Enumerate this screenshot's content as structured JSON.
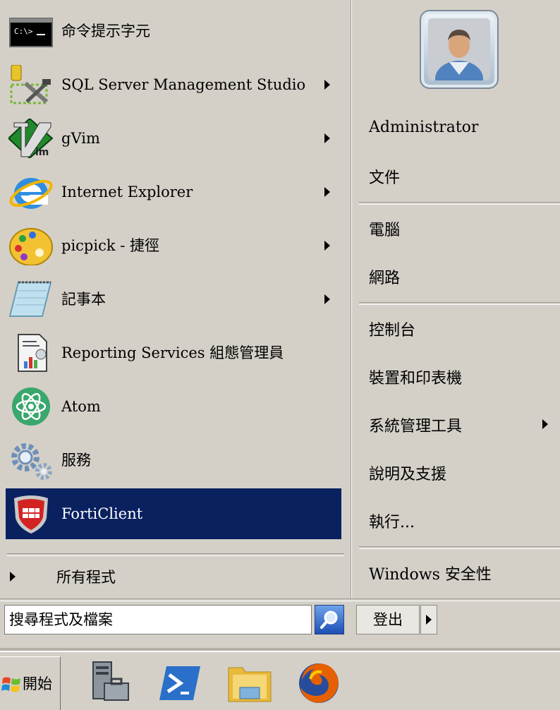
{
  "programs": [
    {
      "label": "命令提示字元",
      "icon": "cmd-icon",
      "submenu": false
    },
    {
      "label": "SQL Server Management Studio",
      "icon": "sql-tools-icon",
      "submenu": true
    },
    {
      "label": "gVim",
      "icon": "gvim-icon",
      "submenu": true
    },
    {
      "label": "Internet Explorer",
      "icon": "internet-explorer-icon",
      "submenu": true
    },
    {
      "label": "picpick - 捷徑",
      "icon": "picpick-palette-icon",
      "submenu": true
    },
    {
      "label": "記事本",
      "icon": "notepad-icon",
      "submenu": true
    },
    {
      "label": "Reporting Services 組態管理員",
      "icon": "reporting-services-icon",
      "submenu": false
    },
    {
      "label": "Atom",
      "icon": "atom-icon",
      "submenu": false
    },
    {
      "label": "服務",
      "icon": "services-gears-icon",
      "submenu": false
    },
    {
      "label": "FortiClient",
      "icon": "forticlient-shield-icon",
      "submenu": false,
      "selected": true
    }
  ],
  "all_programs_label": "所有程式",
  "search": {
    "placeholder": "搜尋程式及檔案"
  },
  "logout_label": "登出",
  "right": {
    "username": "Administrator",
    "documents": "文件",
    "computer": "電腦",
    "network": "網路",
    "control_panel": "控制台",
    "devices_printers": "裝置和印表機",
    "admin_tools": "系統管理工具",
    "help_support": "說明及支援",
    "run": "執行...",
    "windows_security": "Windows 安全性"
  },
  "taskbar": {
    "start_label": "開始",
    "pinned": [
      "server-manager-icon",
      "powershell-icon",
      "file-explorer-icon",
      "firefox-icon"
    ]
  },
  "colors": {
    "selected_bg": "#0a2160",
    "menu_bg": "#d4d0c8"
  }
}
